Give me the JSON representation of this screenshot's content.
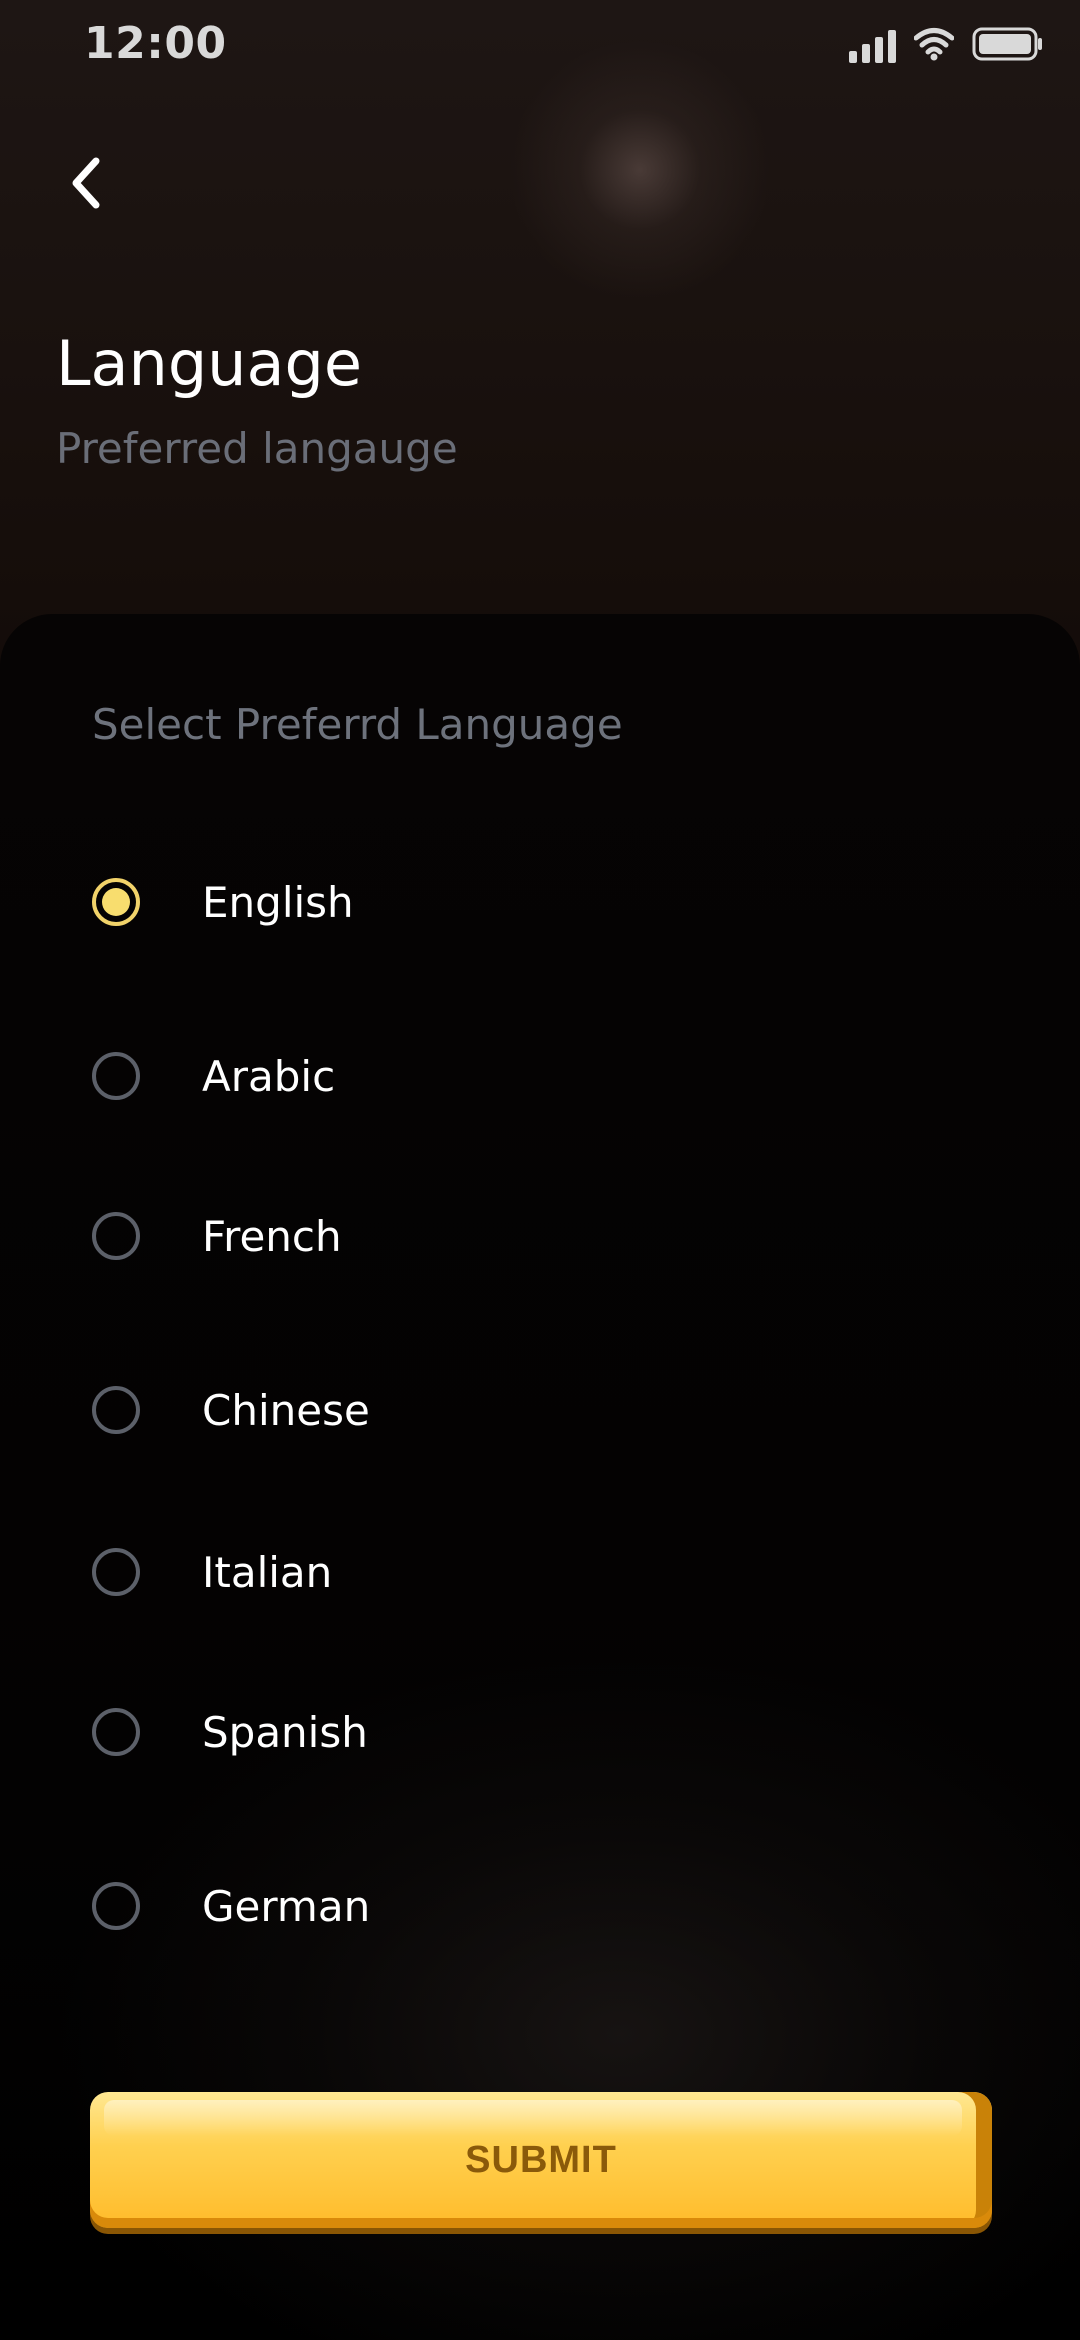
{
  "status_bar": {
    "time": "12:00",
    "icons": [
      "signal-icon",
      "wifi-icon",
      "battery-icon"
    ]
  },
  "header": {
    "back_icon": "chevron-left-icon",
    "title": "Language",
    "subtitle": "Preferred langauge"
  },
  "language_select": {
    "label": "Select Preferrd Language",
    "selected": "English",
    "options": [
      {
        "label": "English",
        "checked": true
      },
      {
        "label": "Arabic",
        "checked": false
      },
      {
        "label": "French",
        "checked": false
      },
      {
        "label": "Chinese",
        "checked": false
      },
      {
        "label": "Italian",
        "checked": false
      },
      {
        "label": "Spanish",
        "checked": false
      },
      {
        "label": "German",
        "checked": false
      }
    ]
  },
  "submit": {
    "label": "SUBMIT"
  },
  "colors": {
    "accent": "#F8DD6E",
    "button_top": "#FFE892",
    "button_bottom": "#FFBB2A",
    "button_text": "#8A5A0A",
    "muted_text": "#6A6E78",
    "radio_border": "#5C6069"
  }
}
